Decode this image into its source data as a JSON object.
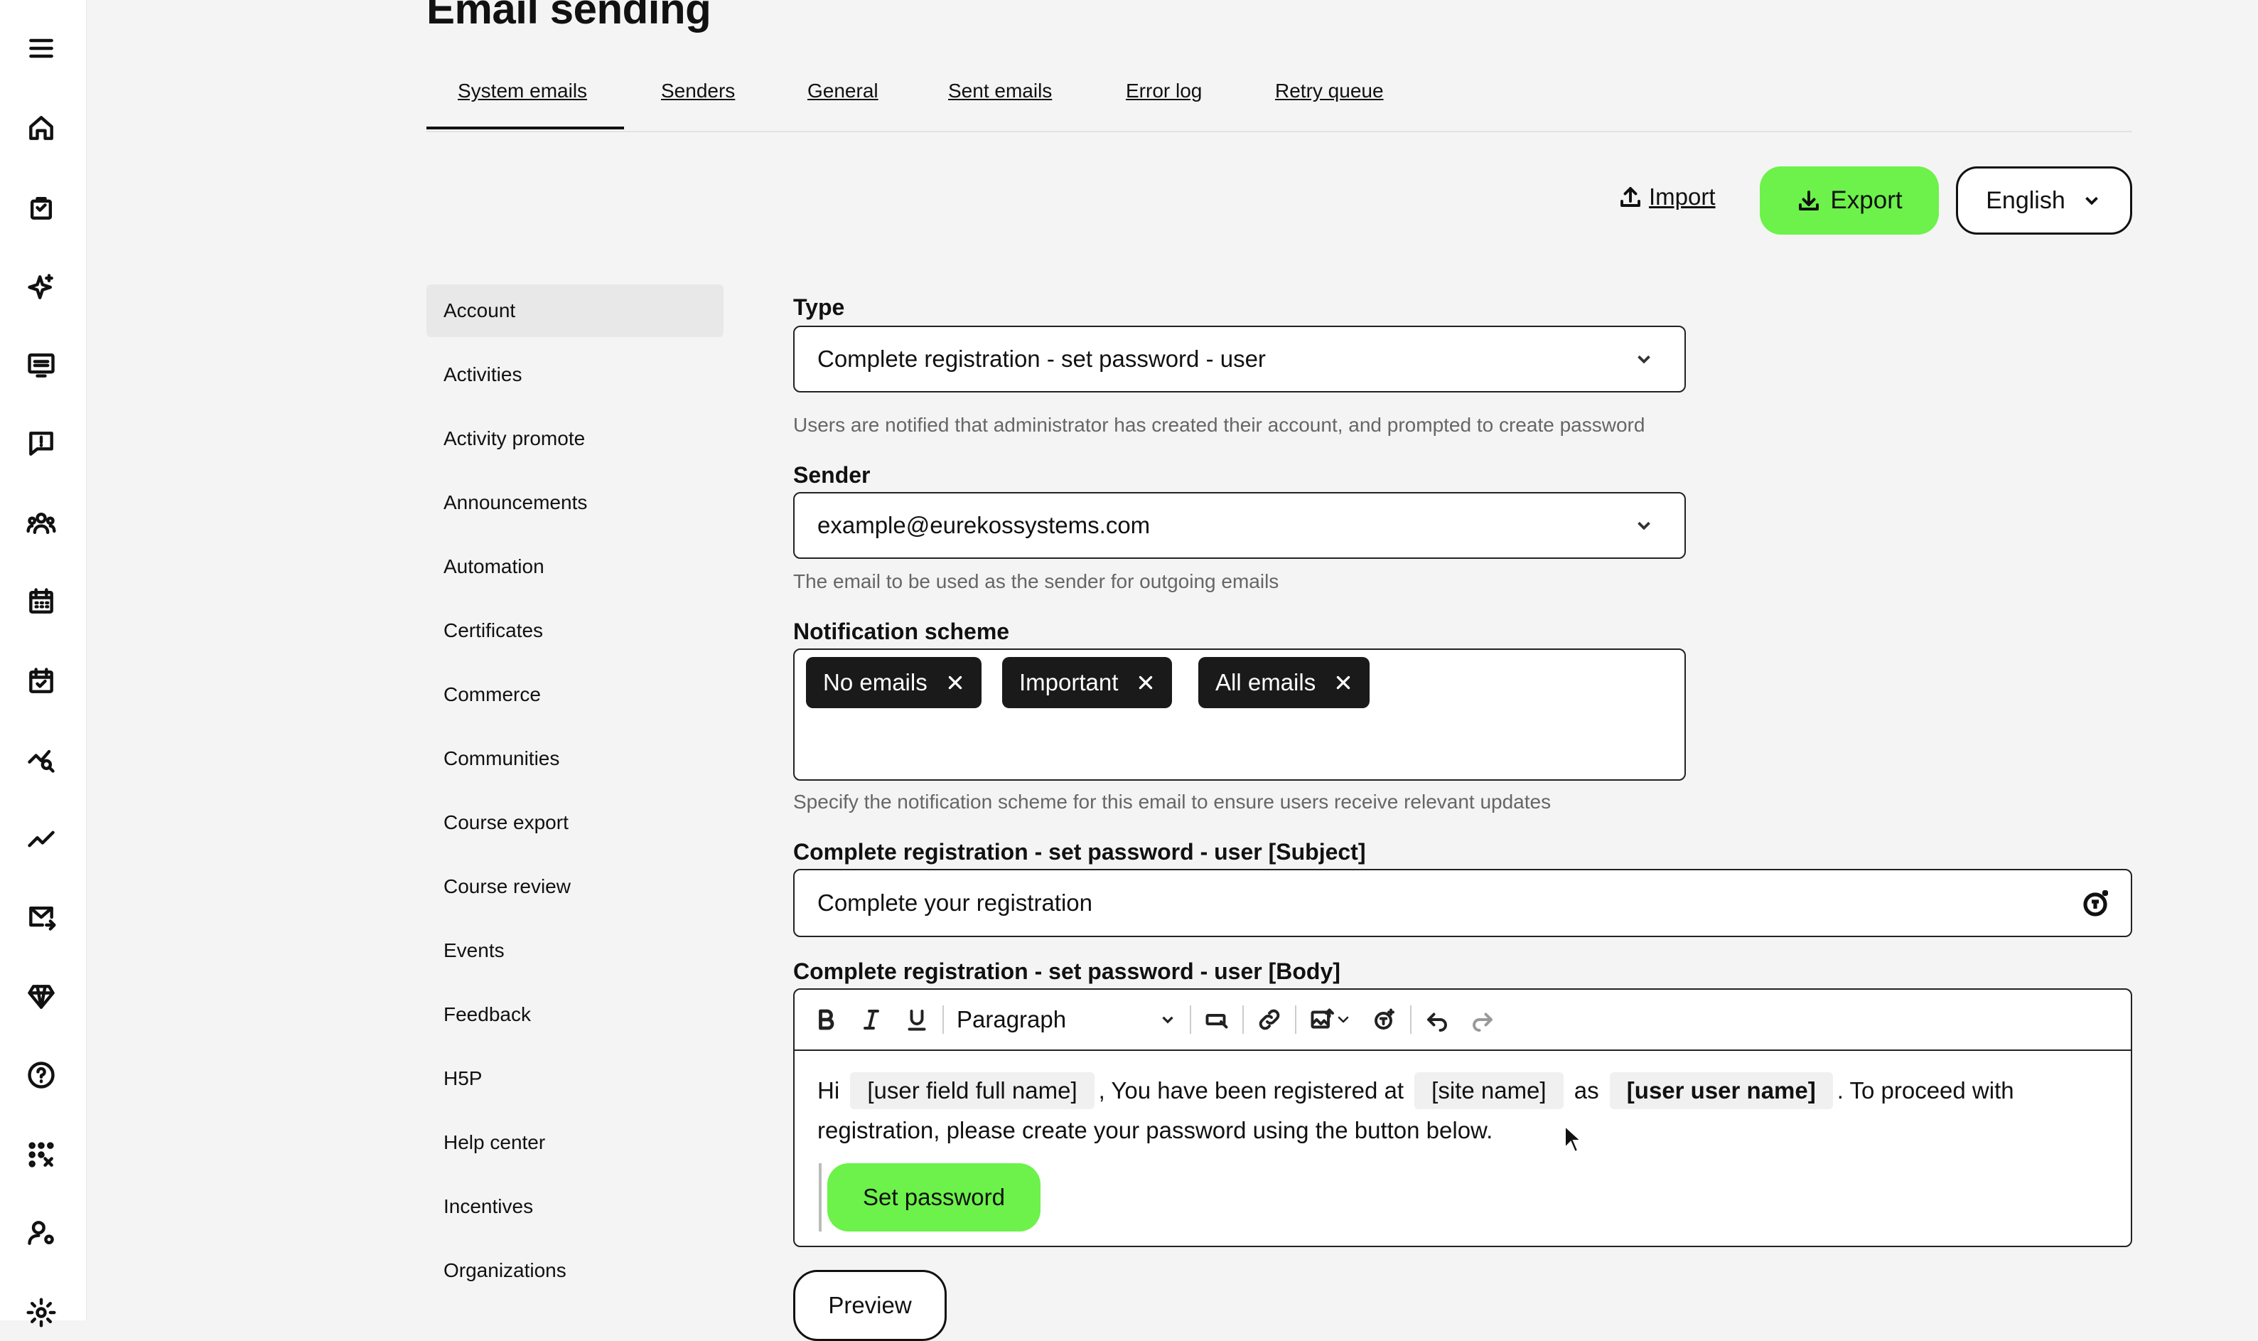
{
  "page": {
    "title": "Email sending"
  },
  "tabs": [
    {
      "label": "System emails",
      "active": true
    },
    {
      "label": "Senders"
    },
    {
      "label": "General"
    },
    {
      "label": "Sent emails"
    },
    {
      "label": "Error log"
    },
    {
      "label": "Retry queue"
    }
  ],
  "actions": {
    "import_label": "Import",
    "export_label": "Export",
    "language": "English"
  },
  "subnav": {
    "items": [
      "Account",
      "Activities",
      "Activity promote",
      "Announcements",
      "Automation",
      "Certificates",
      "Commerce",
      "Communities",
      "Course export",
      "Course review",
      "Events",
      "Feedback",
      "H5P",
      "Help center",
      "Incentives",
      "Organizations"
    ],
    "active": "Account"
  },
  "form": {
    "type_label": "Type",
    "type_value": "Complete registration - set password - user",
    "type_help": "Users are notified that administrator has created their account, and prompted to create password",
    "sender_label": "Sender",
    "sender_value": "example@eurekossystems.com",
    "sender_help": "The email to be used as the sender for outgoing emails",
    "scheme_label": "Notification scheme",
    "scheme_tags": [
      "No emails",
      "Important",
      "All emails"
    ],
    "scheme_help": "Specify the notification scheme for this email to ensure users receive relevant updates",
    "subject_label": "Complete registration - set password - user [Subject]",
    "subject_value": "Complete your registration",
    "body_label": "Complete registration - set password - user [Body]"
  },
  "editor": {
    "block_format": "Paragraph",
    "body": {
      "t1": "Hi",
      "c1": "[user field full name]",
      "t2": ", You have been registered at",
      "c2": "[site name]",
      "t3": "as",
      "c3": "[user user name]",
      "t4": ". To proceed with registration, please create your password using the button below."
    },
    "cta_label": "Set password"
  },
  "footer": {
    "preview_label": "Preview"
  },
  "colors": {
    "accent": "#6cf24a",
    "tag_bg": "#1a1a1a",
    "page_bg": "#f4f4f4"
  },
  "icons": {
    "rail": [
      "menu-icon",
      "home-icon",
      "bag-icon",
      "sparkle-icon",
      "monitor-list-icon",
      "message-alert-icon",
      "users-icon",
      "calendar-grid-icon",
      "calendar-check-icon",
      "chart-search-icon",
      "trend-icon",
      "mail-forward-icon",
      "diamond-icon",
      "help-icon",
      "apps-grid-icon",
      "user-gear-icon",
      "settings-icon"
    ]
  }
}
